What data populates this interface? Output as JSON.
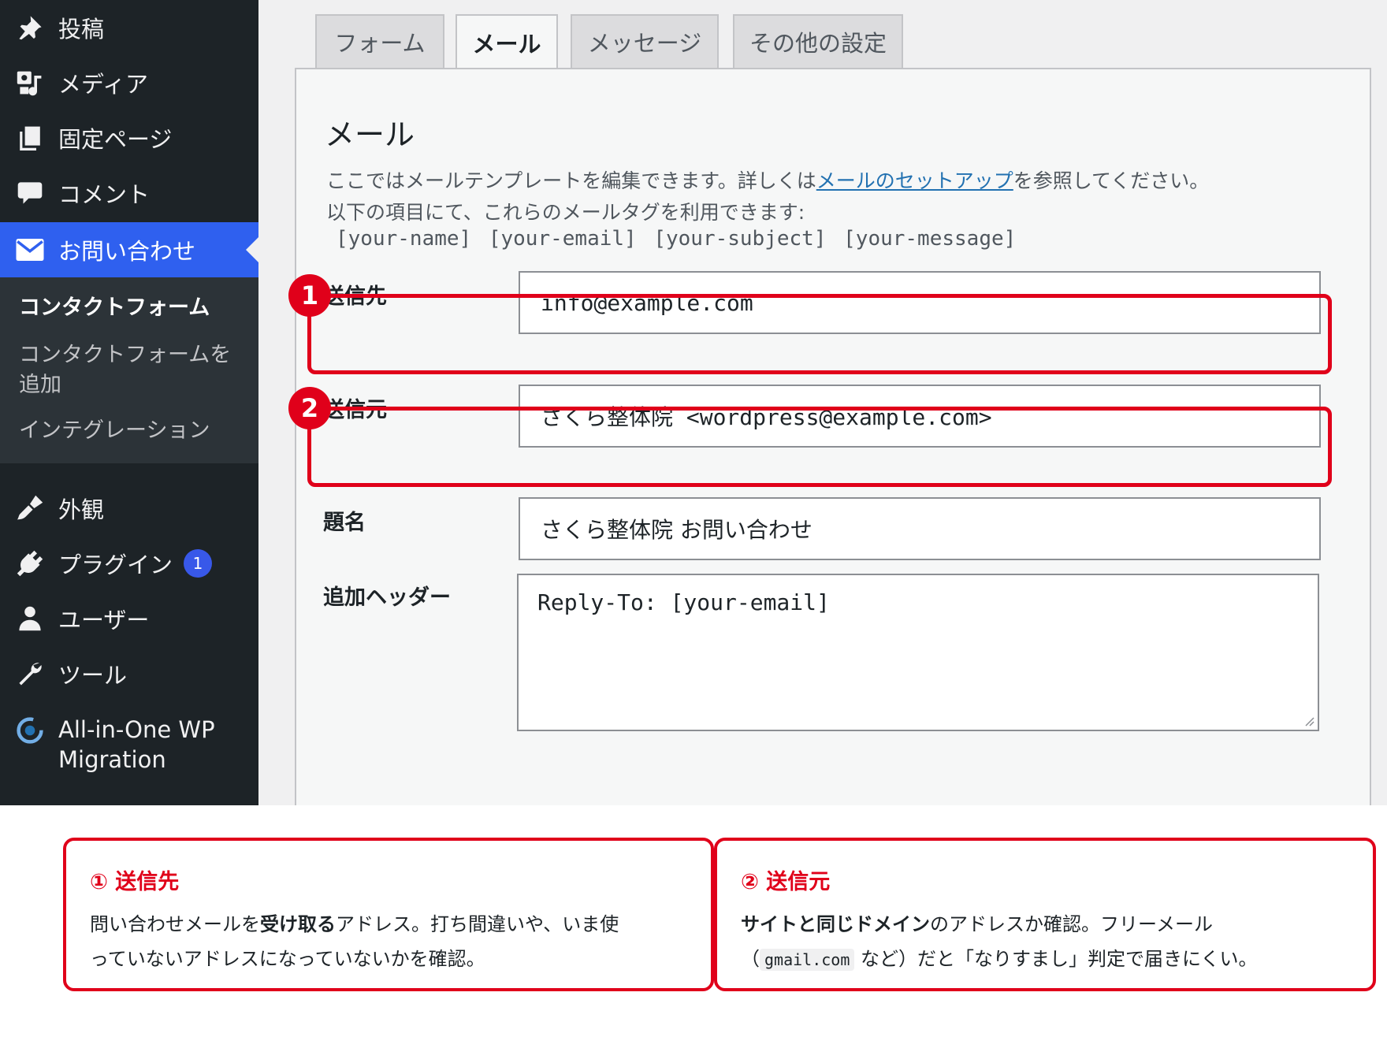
{
  "sidebar": {
    "items": [
      {
        "label": "投稿",
        "icon": "pushpin-icon"
      },
      {
        "label": "メディア",
        "icon": "media-icon"
      },
      {
        "label": "固定ページ",
        "icon": "pages-icon"
      },
      {
        "label": "コメント",
        "icon": "comment-icon"
      },
      {
        "label": "お問い合わせ",
        "icon": "mail-icon"
      },
      {
        "label": "外観",
        "icon": "paintbrush-icon"
      },
      {
        "label": "プラグイン",
        "icon": "plugin-icon",
        "badge": "1"
      },
      {
        "label": "ユーザー",
        "icon": "user-icon"
      },
      {
        "label": "ツール",
        "icon": "wrench-icon"
      },
      {
        "label_line1": "All-in-One WP",
        "label_line2": "Migration",
        "icon": "migration-icon"
      }
    ],
    "submenu": {
      "current": "コンタクトフォーム",
      "add_line1": "コンタクトフォームを",
      "add_line2": "追加",
      "integration": "インテグレーション"
    }
  },
  "tabs": [
    "フォーム",
    "メール",
    "メッセージ",
    "その他の設定"
  ],
  "active_tab": "メール",
  "panel": {
    "title": "メール",
    "desc_before_link": "ここではメールテンプレートを編集できます。詳しくは",
    "desc_link": "メールのセットアップ",
    "desc_after_link": "を参照してください。",
    "desc_line2": "以下の項目にて、これらのメールタグを利用できます:",
    "tags": "[your-name] [your-email] [your-subject] [your-message]"
  },
  "fields": {
    "to": {
      "label": "送信先",
      "value": "info@example.com"
    },
    "from": {
      "label": "送信元",
      "value": "さくら整体院 <wordpress@example.com>"
    },
    "subject": {
      "label": "題名",
      "value": "さくら整体院 お問い合わせ"
    },
    "headers": {
      "label": "追加ヘッダー",
      "value": "Reply-To: [your-email]"
    }
  },
  "markers": [
    "1",
    "2"
  ],
  "callouts": [
    {
      "title": "① 送信先",
      "body_1": "問い合わせメールを",
      "body_bold": "受け取る",
      "body_2": "アドレス。打ち間違いや、いま使",
      "body_3": "っていないアドレスになっていないかを確認。"
    },
    {
      "title": "② 送信元",
      "body_bold": "サイトと同じドメイン",
      "body_1": "のアドレスか確認。フリーメール",
      "body_2": "（",
      "body_code": "gmail.com",
      "body_3": " など）だと「なりすまし」判定で届きにくい。"
    }
  ],
  "colors": {
    "sidebar_bg": "#1d2327",
    "active_menu": "#2f60ef",
    "highlight_red": "#e0001a",
    "link_blue": "#2271b1"
  }
}
